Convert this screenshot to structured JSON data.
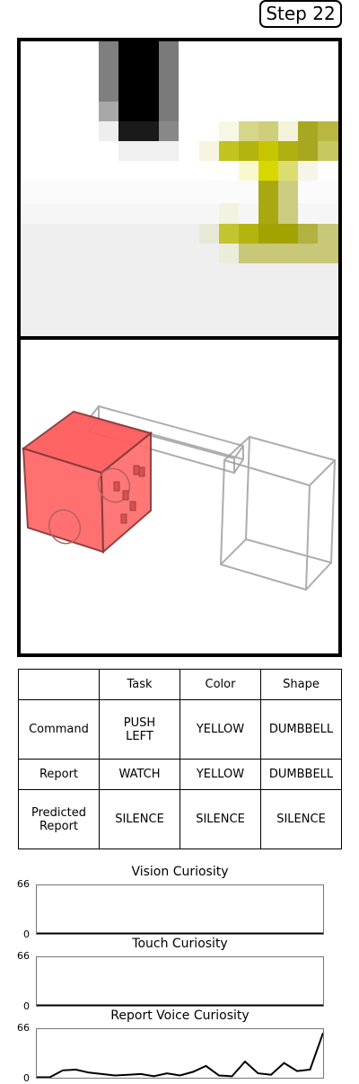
{
  "step": {
    "label": "Step 22"
  },
  "table": {
    "headers": [
      "",
      "Task",
      "Color",
      "Shape"
    ],
    "rows": [
      [
        "Command",
        "PUSH\nLEFT",
        "YELLOW",
        "DUMBBELL"
      ],
      [
        "Report",
        "WATCH",
        "YELLOW",
        "DUMBBELL"
      ],
      [
        "Predicted\nReport",
        "SILENCE",
        "SILENCE",
        "SILENCE"
      ]
    ]
  },
  "curiosity": [
    {
      "title": "Vision Curiosity",
      "max": "66",
      "min": "0",
      "values": [
        0,
        0,
        0,
        0,
        0,
        0,
        0,
        0,
        0,
        0,
        0,
        0,
        0,
        0,
        0,
        0,
        0,
        0,
        0,
        0,
        0,
        0,
        0
      ]
    },
    {
      "title": "Touch Curiosity",
      "max": "66",
      "min": "0",
      "values": [
        0,
        0,
        0,
        0,
        0,
        0,
        0,
        0,
        0,
        0,
        0,
        0,
        0,
        0,
        0,
        0,
        0,
        0,
        0,
        0,
        0,
        0,
        0
      ]
    },
    {
      "title": "Report Voice Curiosity",
      "max": "66",
      "min": "0",
      "values": [
        0,
        0,
        10,
        11,
        7,
        5,
        3,
        4,
        5,
        2,
        6,
        3,
        8,
        16,
        3,
        2,
        22,
        6,
        4,
        20,
        9,
        11,
        61
      ]
    }
  ],
  "colors": {
    "cube": "#ff5c5c",
    "yellow": "#c8c800",
    "line": "#000000"
  }
}
